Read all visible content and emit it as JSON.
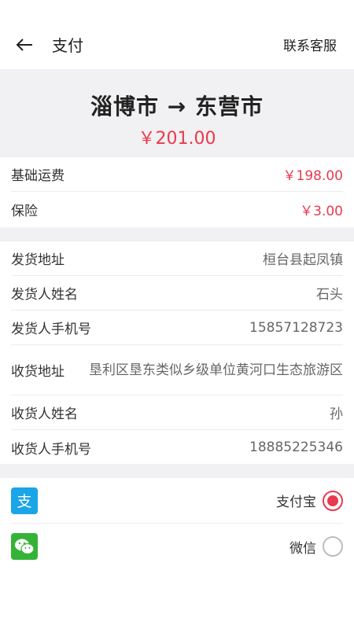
{
  "header": {
    "title": "支付",
    "service_label": "联系客服"
  },
  "order": {
    "route": "淄博市 → 东营市",
    "total": "￥201.00"
  },
  "fees": [
    {
      "label": "基础运费",
      "value": "￥198.00"
    },
    {
      "label": "保险",
      "value": "￥3.00"
    }
  ],
  "details": [
    {
      "label": "发货地址",
      "value": "桓台县起凤镇"
    },
    {
      "label": "发货人姓名",
      "value": "石头"
    },
    {
      "label": "发货人手机号",
      "value": "15857128723"
    },
    {
      "label": "收货地址",
      "value": "垦利区垦东类似乡级单位黄河口生态旅游区"
    },
    {
      "label": "收货人姓名",
      "value": "孙"
    },
    {
      "label": "收货人手机号",
      "value": "18885225346"
    }
  ],
  "payment": {
    "options": [
      {
        "name": "支付宝",
        "icon": "alipay-icon",
        "color": "#1aa5e6",
        "selected": true
      },
      {
        "name": "微信",
        "icon": "wechat-icon",
        "color": "#35b336",
        "selected": false
      }
    ]
  },
  "colors": {
    "accent": "#e83a4f",
    "background_gray": "#f1f0f2"
  }
}
